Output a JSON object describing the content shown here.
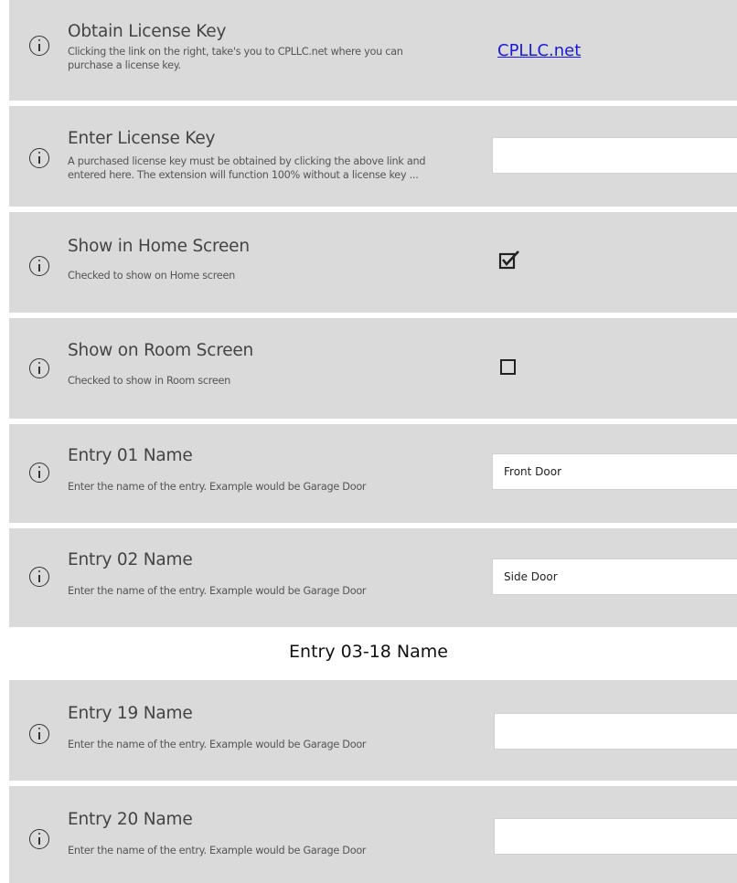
{
  "rows": {
    "obtain": {
      "title": "Obtain License Key",
      "desc1": "Clicking the link on the right, take's you to CPLLC.net where you can",
      "desc2": "purchase a license key.",
      "link": "CPLLC.net"
    },
    "enter": {
      "title": "Enter License Key",
      "desc1": "A purchased license key must be obtained by clicking the above link and",
      "desc2": "entered here. The extension will function 100% without a license key ...",
      "value": ""
    },
    "home": {
      "title": "Show in Home Screen",
      "desc": "Checked to show on Home screen",
      "checked": true
    },
    "room": {
      "title": "Show on Room Screen",
      "desc": "Checked to show in Room screen",
      "checked": false
    },
    "entry01": {
      "title": "Entry 01 Name",
      "desc": "Enter the name of the entry.  Example would be Garage Door",
      "value": "Front Door"
    },
    "entry02": {
      "title": "Entry 02 Name",
      "desc": "Enter the name of the entry.  Example would be Garage Door",
      "value": "Side Door"
    },
    "entry19": {
      "title": "Entry 19 Name",
      "desc": "Enter the name of the entry.  Example would be Garage Door",
      "value": ""
    },
    "entry20": {
      "title": "Entry 20 Name",
      "desc": "Enter the name of the entry.  Example would be Garage Door",
      "value": ""
    }
  },
  "section_label": "Entry 03-18 Name",
  "icons": {
    "info": "info-circle-icon",
    "checkmark": "checkmark-icon"
  },
  "colors": {
    "panel": "#dadada",
    "link": "#1a1ad6"
  }
}
